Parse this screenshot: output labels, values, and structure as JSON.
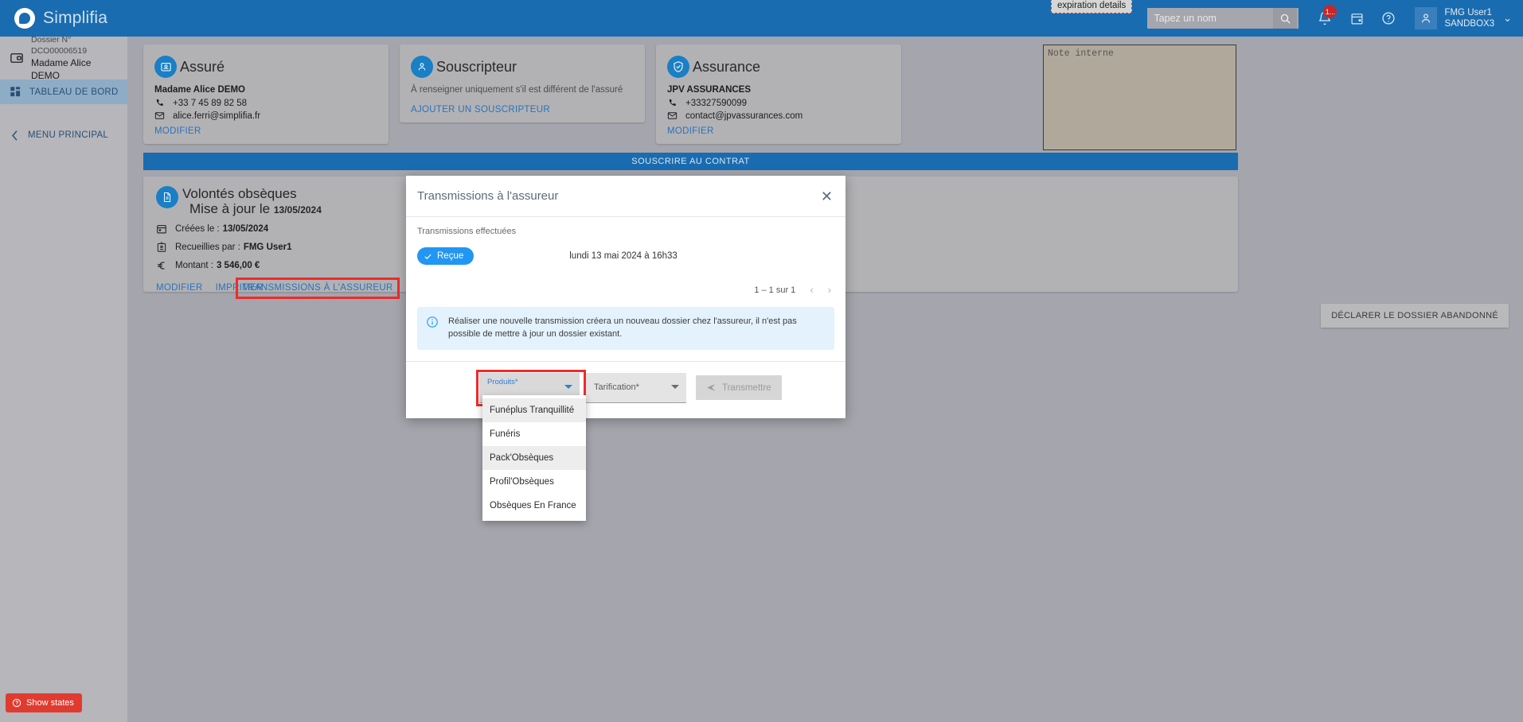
{
  "app": {
    "brand": "Simplifia"
  },
  "topbar": {
    "tooltip": "expiration details",
    "search_placeholder": "Tapez un nom",
    "search_icon": "search-icon",
    "notification_badge": "1...",
    "user_line1": "FMG User1",
    "user_line2": "SANDBOX3"
  },
  "sidebar": {
    "dossier_number": "Dossier N° DCO00006519",
    "dossier_name": "Madame Alice DEMO",
    "item_dashboard": "TABLEAU DE BORD",
    "menu_principal": "MENU PRINCIPAL"
  },
  "cards": {
    "assure": {
      "title": "Assuré",
      "name": "Madame Alice DEMO",
      "phone": "+33 7 45 89 82 58",
      "email": "alice.ferri@simplifia.fr",
      "link": "MODIFIER"
    },
    "souscripteur": {
      "title": "Souscripteur",
      "note": "À renseigner uniquement s'il est différent de l'assuré",
      "link": "AJOUTER UN SOUSCRIPTEUR"
    },
    "assurance": {
      "title": "Assurance",
      "name": "JPV ASSURANCES",
      "phone": "+33327590099",
      "email": "contact@jpvassurances.com",
      "link": "MODIFIER"
    }
  },
  "note": {
    "placeholder": "Note interne",
    "value": ""
  },
  "souscrire_bar": "SOUSCRIRE AU CONTRAT",
  "volontes": {
    "title": "Volontés obsèques",
    "subtitle": "Mise à jour le",
    "subtitle_date": "13/05/2024",
    "created_label": "Créées le :",
    "created_date": "13/05/2024",
    "collected_label": "Recueillies par :",
    "collected_by": "FMG User1",
    "amount_label": "Montant :",
    "amount": "3 546,00 €",
    "link_modifier": "MODIFIER",
    "link_imprimer": "IMPRIMER",
    "link_transmissions": "TRANSMISSIONS À L'ASSUREUR"
  },
  "abandon_button": "DÉCLARER LE DOSSIER ABANDONNÉ",
  "show_states": "Show states",
  "modal": {
    "title": "Transmissions à l'assureur",
    "close_icon": "close-icon",
    "section_label": "Transmissions effectuées",
    "status_pill": "Reçue",
    "transmission_date": "lundi 13 mai 2024 à 16h33",
    "pager_text": "1 – 1 sur 1",
    "prev_icon": "chevron-left-icon",
    "next_icon": "chevron-right-icon",
    "info_text": "Réaliser une nouvelle transmission créera un nouveau dossier chez l'assureur, il n'est pas possible de mettre à jour un dossier existant.",
    "select_produits_label": "Produits*",
    "select_produits_value": "",
    "select_tarification_label": "Tarification*",
    "select_tarification_value": "",
    "transmettre_button": "Transmettre"
  },
  "dropdown": {
    "options": [
      "Funéplus Tranquillité",
      "Funéris",
      "Pack'Obsèques",
      "Profil'Obsèques",
      "Obsèques En France"
    ]
  },
  "colors": {
    "brand_blue": "#1a6cb0",
    "accent_blue": "#2196f3",
    "highlight_red": "#ef2b2b",
    "badge_red": "#c62828",
    "info_bg": "#e3f2fd"
  }
}
